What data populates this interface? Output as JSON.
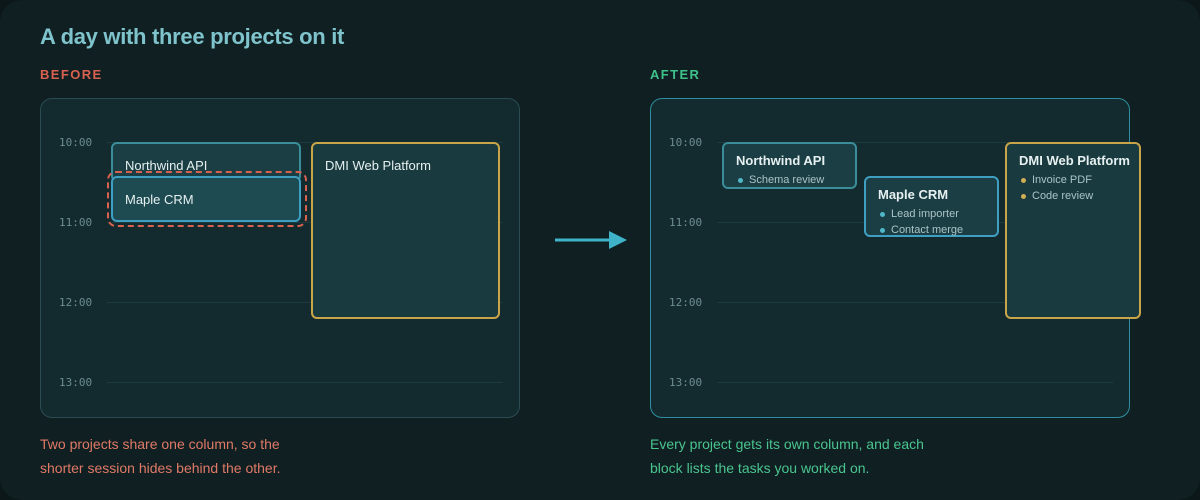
{
  "title": "A day with three projects on it",
  "before": {
    "label": "BEFORE",
    "times": [
      "10:00",
      "11:00",
      "12:00",
      "13:00"
    ],
    "blocks": [
      {
        "name": "Northwind API"
      },
      {
        "name": "Maple CRM"
      },
      {
        "name": "DMI Web Platform"
      }
    ],
    "caption_line1": "Two projects share one column, so the",
    "caption_line2": "shorter session hides behind the other."
  },
  "after": {
    "label": "AFTER",
    "times": [
      "10:00",
      "11:00",
      "12:00",
      "13:00"
    ],
    "blocks": [
      {
        "name": "Northwind API",
        "tasks": [
          "Schema review"
        ]
      },
      {
        "name": "Maple CRM",
        "tasks": [
          "Lead importer",
          "Contact merge"
        ]
      },
      {
        "name": "DMI Web Platform",
        "tasks": [
          "Invoice PDF",
          "Code review"
        ]
      }
    ],
    "caption_line1": "Every project gets its own column, and each",
    "caption_line2": "block lists the tasks you worked on."
  },
  "colors": {
    "before_accent": "#d9614f",
    "after_accent": "#3ec28a",
    "blue_border": "#3f9fc2",
    "gold_border": "#c9a54a"
  },
  "icons": {
    "transition": "arrow-right-icon"
  }
}
